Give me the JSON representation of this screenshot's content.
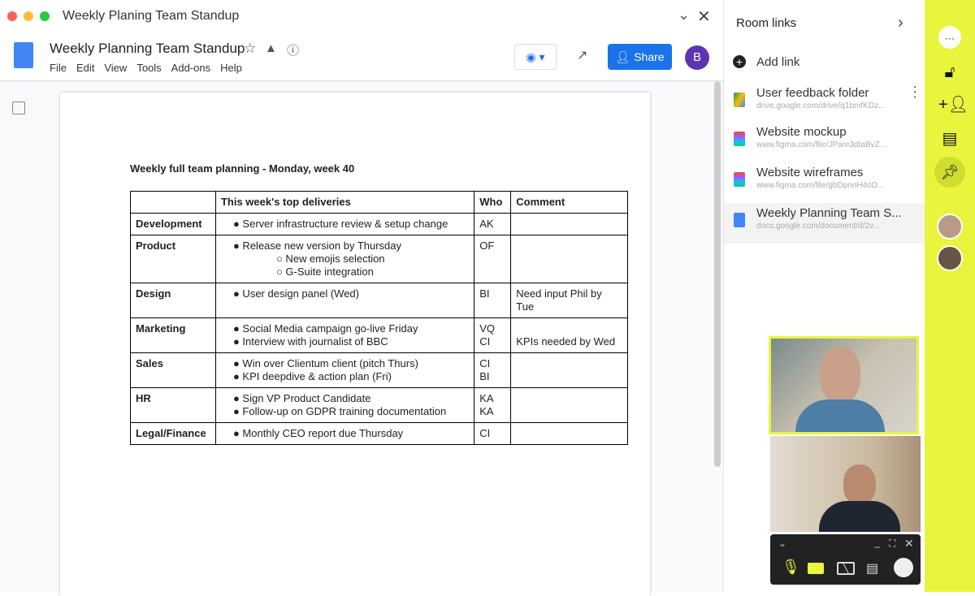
{
  "window": {
    "title": "Weekly Planing Team Standup"
  },
  "doc": {
    "title": "Weekly Planning Team Standup",
    "menu": [
      "File",
      "Edit",
      "View",
      "Tools",
      "Add-ons",
      "Help"
    ],
    "share": "Share",
    "avatar": "B"
  },
  "content": {
    "heading": "Weekly full team planning - Monday, week 40",
    "headers": [
      "",
      "This week's top deliveries",
      "Who",
      "Comment"
    ],
    "rows": [
      {
        "team": "Development",
        "items": [
          "● Server infrastructure review & setup change"
        ],
        "who": "AK",
        "comment": ""
      },
      {
        "team": "Product",
        "items": [
          "● Release new version by Thursday",
          "○   New emojis selection",
          "○   G-Suite integration"
        ],
        "who": "OF",
        "comment": ""
      },
      {
        "team": "Design",
        "items": [
          "● User design panel (Wed)"
        ],
        "who": "BI",
        "comment": "Need input Phil by Tue"
      },
      {
        "team": "Marketing",
        "items": [
          "● Social Media campaign go-live Friday",
          "● Interview with journalist of BBC"
        ],
        "who": "VQ\nCI",
        "comment": "KPIs needed by Wed"
      },
      {
        "team": "Sales",
        "items": [
          "● Win over Clientum client (pitch Thurs)",
          "● KPI deepdive & action plan (Fri)"
        ],
        "who": "CI\nBI",
        "comment": ""
      },
      {
        "team": "HR",
        "items": [
          "● Sign VP Product Candidate",
          "● Follow-up on GDPR training documentation"
        ],
        "who": "KA\nKA",
        "comment": ""
      },
      {
        "team": "Legal/Finance",
        "items": [
          "● Monthly CEO report due Thursday"
        ],
        "who": "CI",
        "comment": ""
      }
    ]
  },
  "panel": {
    "title": "Room links",
    "add": "Add link",
    "links": [
      {
        "title": "User feedback folder",
        "url": "drive.google.com/drive/q1bmfKDz...",
        "icon": "drive"
      },
      {
        "title": "Website mockup",
        "url": "www.figma.com/file/JPare3dtaBvZ...",
        "icon": "figma"
      },
      {
        "title": "Website wireframes",
        "url": "www.figma.com/file/gbDpnnH4cO...",
        "icon": "figma"
      },
      {
        "title": "Weekly Planning Team S...",
        "url": "docs.google.com/document/d/2v...",
        "icon": "docs"
      }
    ]
  },
  "colors": {
    "rail": "#e8f53c",
    "accent": "#1a73e8"
  }
}
